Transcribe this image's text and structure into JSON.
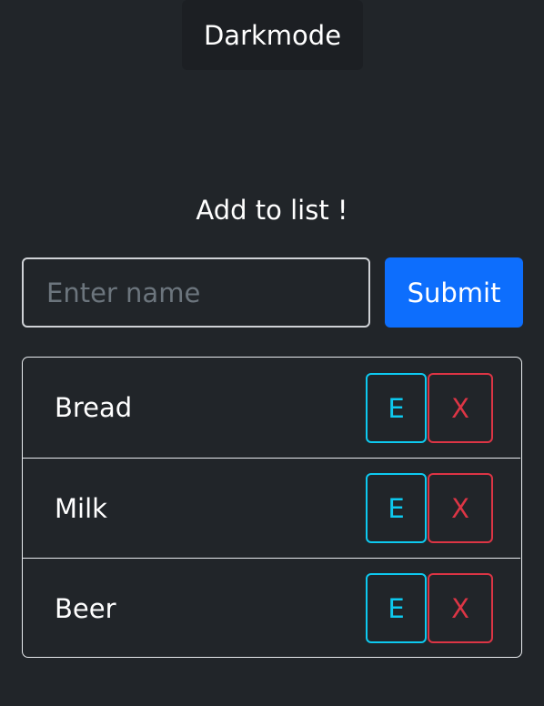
{
  "header": {
    "darkmode_label": "Darkmode"
  },
  "form": {
    "heading": "Add to list !",
    "input_placeholder": "Enter name",
    "input_value": "",
    "submit_label": "Submit"
  },
  "list": {
    "items": [
      {
        "label": "Bread",
        "edit_label": "E",
        "delete_label": "X"
      },
      {
        "label": "Milk",
        "edit_label": "E",
        "delete_label": "X"
      },
      {
        "label": "Beer",
        "edit_label": "E",
        "delete_label": "X"
      }
    ]
  },
  "colors": {
    "background": "#212529",
    "primary": "#0d6efd",
    "info": "#0dcaf0",
    "danger": "#dc3545"
  }
}
